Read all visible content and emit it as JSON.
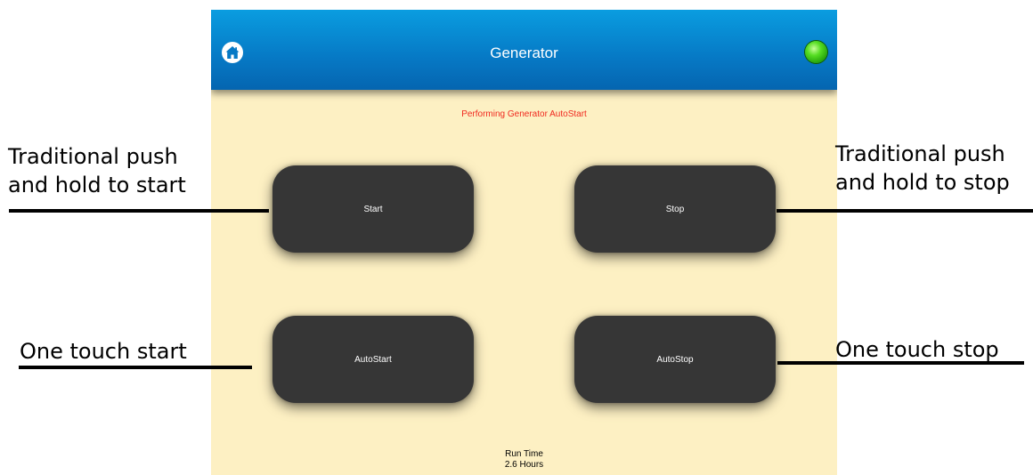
{
  "header": {
    "title": "Generator",
    "home_icon": "home-icon",
    "status_indicator_color": "#3ccc14"
  },
  "status_message": "Performing Generator AutoStart",
  "buttons": {
    "start": "Start",
    "stop": "Stop",
    "autostart": "AutoStart",
    "autostop": "AutoStop"
  },
  "run_time": {
    "label": "Run Time",
    "value": "2.6 Hours"
  },
  "annotations": {
    "start_line1": "Traditional push",
    "start_line2": "and hold to start",
    "stop_line1": "Traditional push",
    "stop_line2": "and hold to stop",
    "autostart": "One touch start",
    "autostop": "One touch stop"
  },
  "colors": {
    "header_blue": "#0679c5",
    "background_cream": "#fdf0c3",
    "button_dark": "#363636",
    "status_text_red": "#f0281e"
  }
}
